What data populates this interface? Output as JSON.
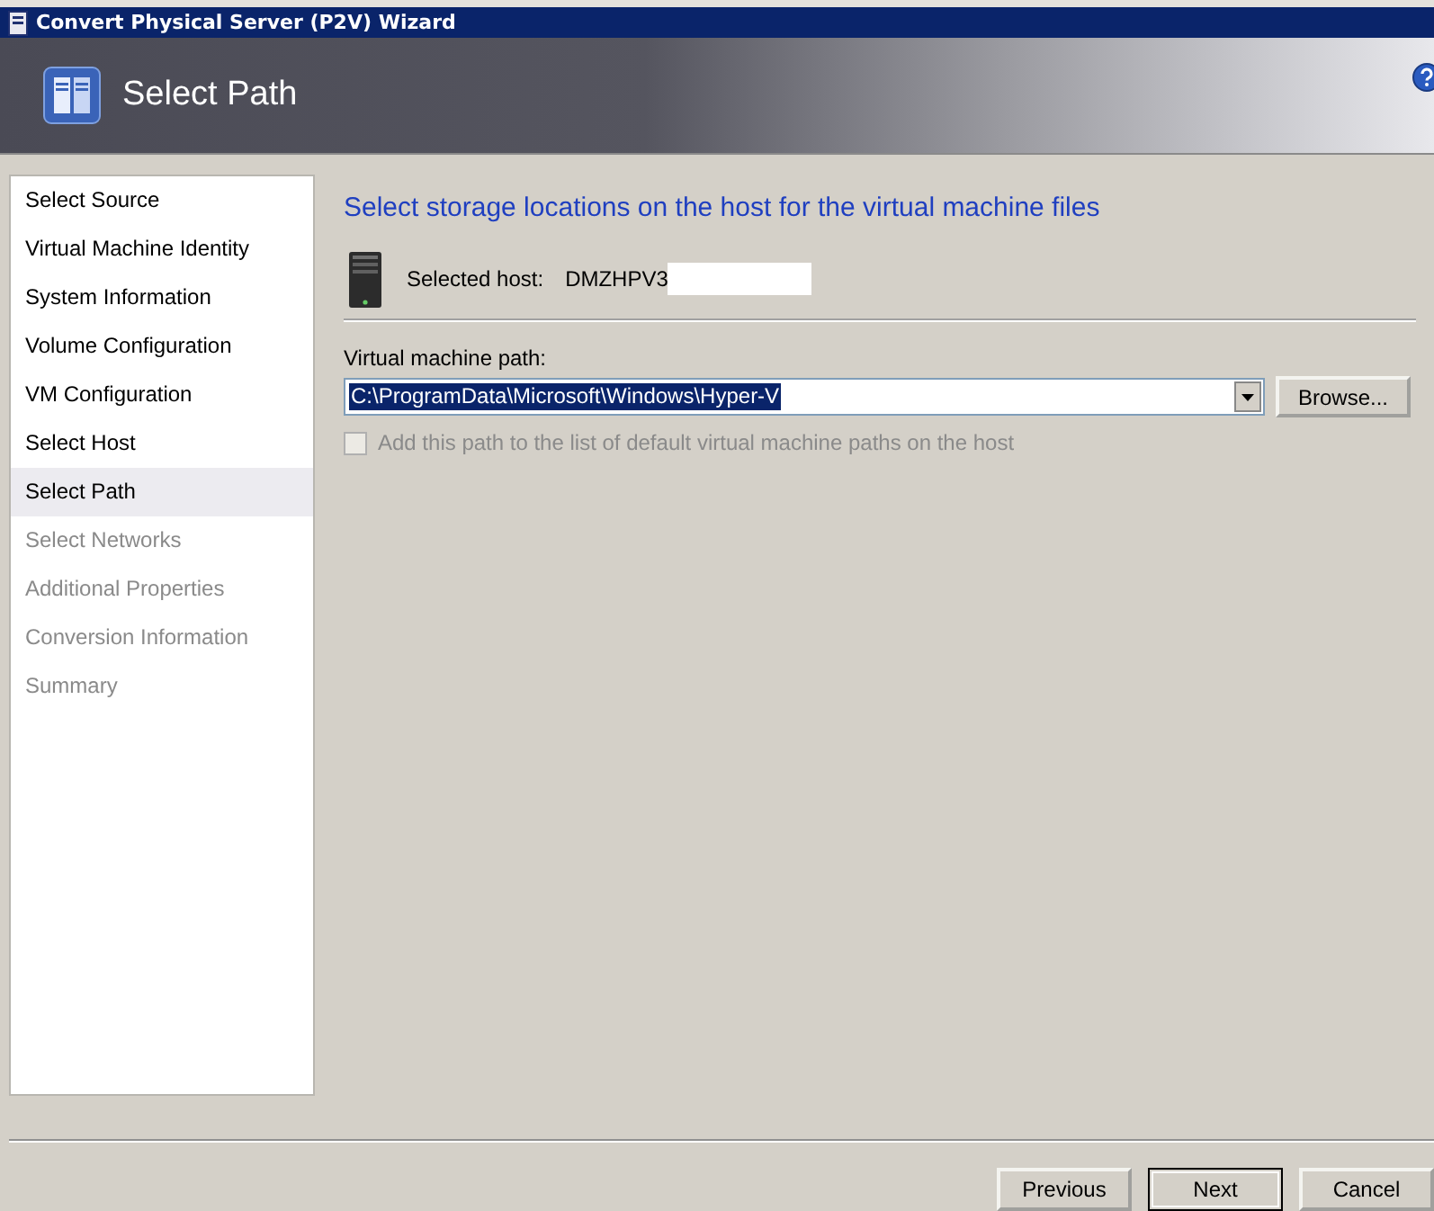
{
  "window": {
    "title": "Convert Physical Server (P2V) Wizard"
  },
  "header": {
    "title": "Select Path"
  },
  "steps": [
    {
      "label": "Select Source",
      "selected": false,
      "disabled": false
    },
    {
      "label": "Virtual Machine Identity",
      "selected": false,
      "disabled": false
    },
    {
      "label": "System Information",
      "selected": false,
      "disabled": false
    },
    {
      "label": "Volume Configuration",
      "selected": false,
      "disabled": false
    },
    {
      "label": "VM Configuration",
      "selected": false,
      "disabled": false
    },
    {
      "label": "Select Host",
      "selected": false,
      "disabled": false
    },
    {
      "label": "Select Path",
      "selected": true,
      "disabled": false
    },
    {
      "label": "Select Networks",
      "selected": false,
      "disabled": true
    },
    {
      "label": "Additional Properties",
      "selected": false,
      "disabled": true
    },
    {
      "label": "Conversion Information",
      "selected": false,
      "disabled": true
    },
    {
      "label": "Summary",
      "selected": false,
      "disabled": true
    }
  ],
  "content": {
    "heading": "Select storage locations on the host for the virtual machine files",
    "host_label": "Selected host:",
    "host_name": "DMZHPV3",
    "path_label": "Virtual machine path:",
    "path_value": "C:\\ProgramData\\Microsoft\\Windows\\Hyper-V",
    "path_selected": true,
    "browse": "Browse...",
    "checkbox": {
      "label": "Add this path to the list of default virtual machine paths on the host",
      "checked": false,
      "disabled": true
    }
  },
  "buttons": [
    {
      "label": "Previous",
      "default": false
    },
    {
      "label": "Next",
      "default": true
    },
    {
      "label": "Cancel",
      "default": false
    }
  ]
}
